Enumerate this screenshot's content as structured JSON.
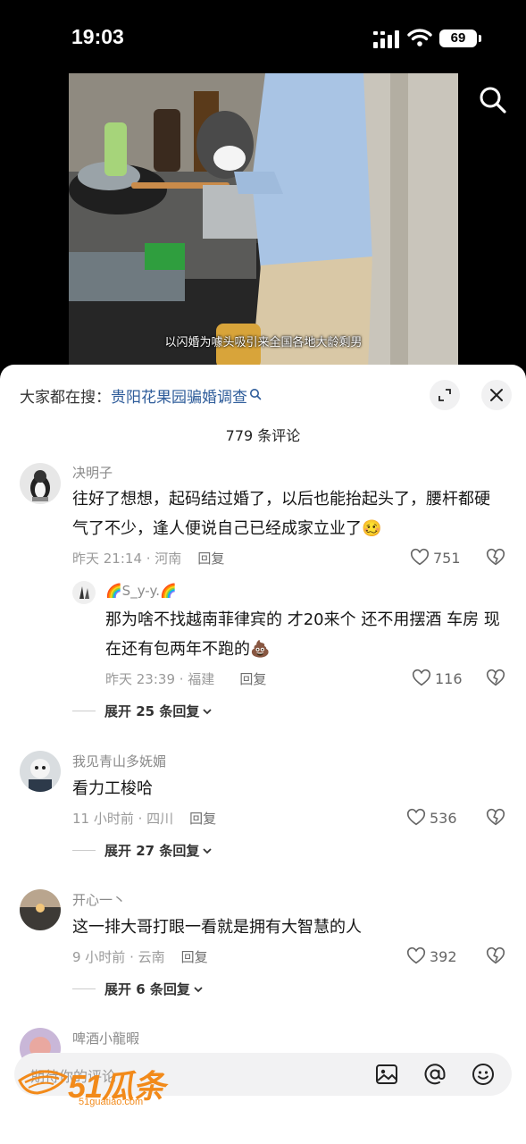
{
  "status_bar": {
    "time": "19:03",
    "battery": "69"
  },
  "video": {
    "caption": "以闪婚为噱头吸引来全国各地大龄剩男"
  },
  "panel": {
    "hot_search_prefix": "大家都在搜：",
    "hot_search_term": "贵阳花果园骗婚调查",
    "comment_count": "779 条评论"
  },
  "comments": [
    {
      "user": "决明子",
      "text": "往好了想想，起码结过婚了，以后也能抬起头了，腰杆都硬气了不少，逢人便说自己已经成家立业了🥴",
      "meta": "昨天 21:14 · 河南",
      "reply_label": "回复",
      "likes": "751",
      "reply": {
        "user": "🌈S_y-y.🌈",
        "text": "那为啥不找越南菲律宾的  才20来个  还不用摆酒 车房  现在还有包两年不跑的💩",
        "meta": "昨天 23:39 · 福建",
        "reply_label": "回复",
        "likes": "116"
      },
      "expand": "展开 25 条回复"
    },
    {
      "user": "我见青山多妩媚",
      "text": "看力工梭哈",
      "meta": "11 小时前 · 四川",
      "reply_label": "回复",
      "likes": "536",
      "expand": "展开 27 条回复"
    },
    {
      "user": "开心一丶",
      "text": "这一排大哥打眼一看就是拥有大智慧的人",
      "meta": "9 小时前 · 云南",
      "reply_label": "回复",
      "likes": "392",
      "expand": "展开 6 条回复"
    },
    {
      "user": "啤酒小龍暇"
    }
  ],
  "input": {
    "placeholder": "期待你的评论"
  },
  "watermark": {
    "brand": "51瓜条",
    "site": "51guatiao.com"
  },
  "icons": {
    "search": "search-icon",
    "expand": "expand-icon",
    "close": "close-icon",
    "like": "heart-icon",
    "dislike": "broken-heart-icon",
    "image": "image-icon",
    "mention": "at-icon",
    "emoji": "emoji-icon"
  },
  "colors": {
    "link": "#2e5c9a",
    "watermark": "#f28a1a"
  }
}
